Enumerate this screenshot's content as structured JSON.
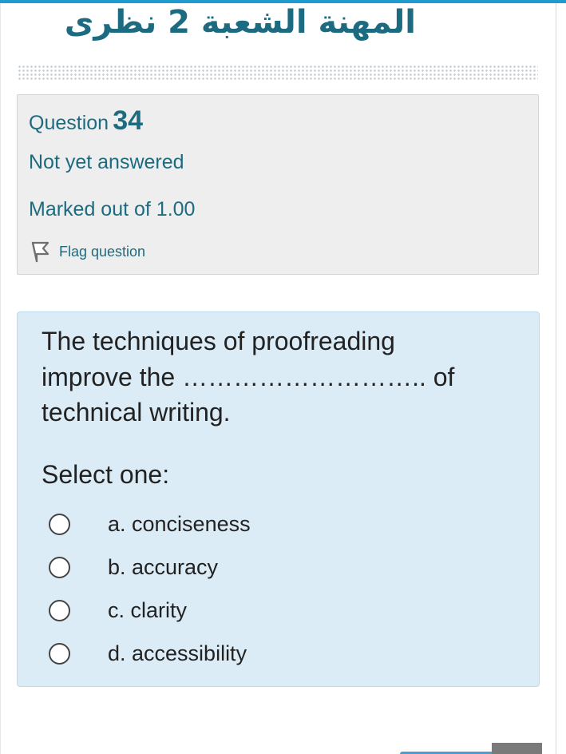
{
  "course": {
    "title": "المهنة الشعبة 2 نظرى"
  },
  "info": {
    "question_word": "Question",
    "question_number": "34",
    "state": "Not yet answered",
    "grade": "Marked out of 1.00",
    "flag_label": "Flag question",
    "flag_icon": "flag-icon"
  },
  "question": {
    "text": "The techniques of proofreading improve the ……………………….. of technical writing.",
    "prompt": "Select one:",
    "options": [
      {
        "label": "a. conciseness",
        "selected": false
      },
      {
        "label": "b. accuracy",
        "selected": false
      },
      {
        "label": "c. clarity",
        "selected": false
      },
      {
        "label": "d. accessibility",
        "selected": false
      }
    ]
  },
  "colors": {
    "accent": "#1d6b80",
    "top_bar": "#1f9bd0",
    "info_background": "#eeeeee",
    "question_background": "#dcecf6"
  }
}
